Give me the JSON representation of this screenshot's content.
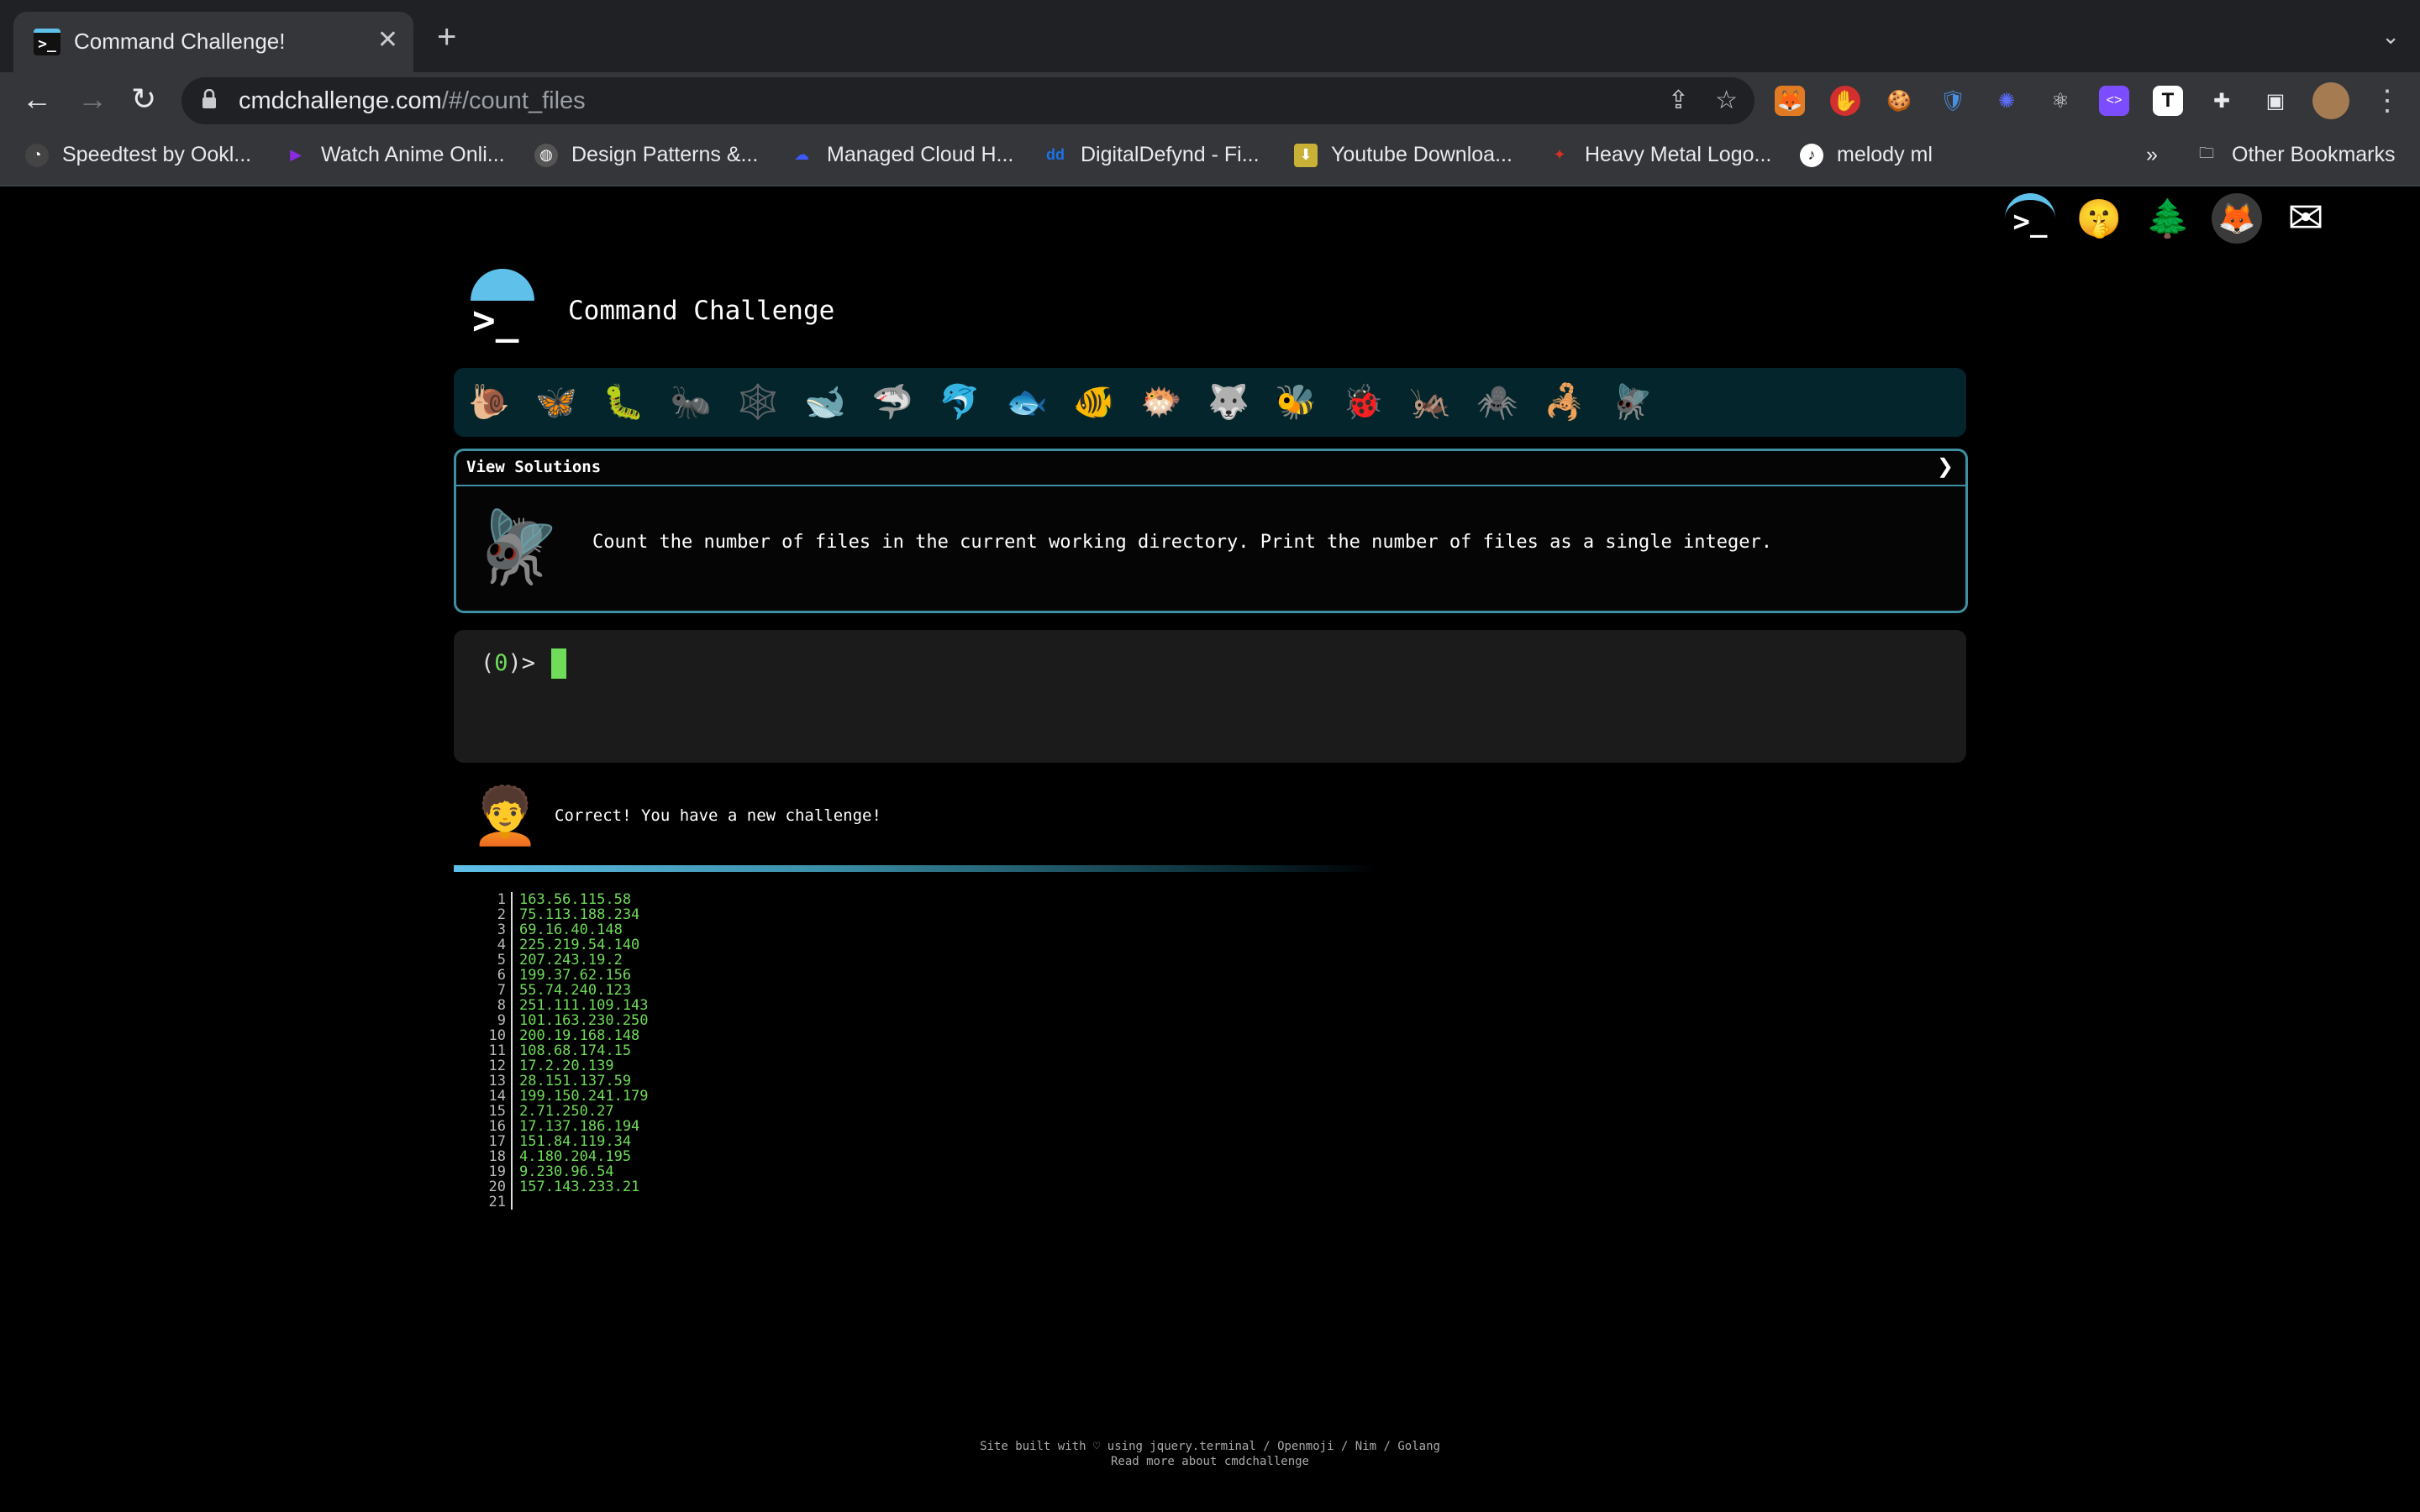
{
  "browser": {
    "tab_title": "Command Challenge!",
    "tab_favicon": ">_",
    "url_domain": "cmdchallenge.com",
    "url_path": "/#/count_files",
    "bookmarks": [
      {
        "label": "Speedtest by Ookl...",
        "icon": "speedtest-icon",
        "color": "#444"
      },
      {
        "label": "Watch Anime Onli...",
        "icon": "play-icon",
        "color": "#8a2be2"
      },
      {
        "label": "Design Patterns &...",
        "icon": "globe-icon",
        "color": "#555"
      },
      {
        "label": "Managed Cloud H...",
        "icon": "cloud-icon",
        "color": "#3d5afe"
      },
      {
        "label": "DigitalDefynd - Fi...",
        "icon": "dd-icon",
        "color": "#1a73e8"
      },
      {
        "label": "Youtube Downloa...",
        "icon": "download-icon",
        "color": "#c9b037"
      },
      {
        "label": "Heavy Metal Logo...",
        "icon": "flame-icon",
        "color": "#d93025"
      },
      {
        "label": "melody ml",
        "icon": "music-note-icon",
        "color": "#111"
      }
    ],
    "overflow": "»",
    "other_bookmarks": "Other Bookmarks"
  },
  "header": {
    "site_title": "Command Challenge",
    "logo_glyph": ">_"
  },
  "critters": [
    "🐌",
    "🦋",
    "🐛",
    "🐜",
    "🕸️",
    "🐋",
    "🦈",
    "🐬",
    "🐟",
    "🐠",
    "🐡",
    "🐺",
    "🐝",
    "🐞",
    "🦗",
    "🕷️",
    "🦂",
    "🪰"
  ],
  "challenge": {
    "view_solutions": "View Solutions",
    "chevron": "❯",
    "icon": "🪰",
    "text": "Count the number of files in the current working directory. Print the number of files as a single integer."
  },
  "terminal": {
    "prompt_open": "(",
    "prompt_count": "0",
    "prompt_close": ")>"
  },
  "feedback": {
    "avatar": "🧑‍🦱",
    "text": "Correct! You have a new challenge!"
  },
  "files": [
    {
      "n": "1",
      "ip": "163.56.115.58"
    },
    {
      "n": "2",
      "ip": "75.113.188.234"
    },
    {
      "n": "3",
      "ip": "69.16.40.148"
    },
    {
      "n": "4",
      "ip": "225.219.54.140"
    },
    {
      "n": "5",
      "ip": "207.243.19.2"
    },
    {
      "n": "6",
      "ip": "199.37.62.156"
    },
    {
      "n": "7",
      "ip": "55.74.240.123"
    },
    {
      "n": "8",
      "ip": "251.111.109.143"
    },
    {
      "n": "9",
      "ip": "101.163.230.250"
    },
    {
      "n": "10",
      "ip": "200.19.168.148"
    },
    {
      "n": "11",
      "ip": "108.68.174.15"
    },
    {
      "n": "12",
      "ip": "17.2.20.139"
    },
    {
      "n": "13",
      "ip": "28.151.137.59"
    },
    {
      "n": "14",
      "ip": "199.150.241.179"
    },
    {
      "n": "15",
      "ip": "2.71.250.27"
    },
    {
      "n": "16",
      "ip": "17.137.186.194"
    },
    {
      "n": "17",
      "ip": "151.84.119.34"
    },
    {
      "n": "18",
      "ip": "4.180.204.195"
    },
    {
      "n": "19",
      "ip": "9.230.96.54"
    },
    {
      "n": "20",
      "ip": "157.143.233.21"
    },
    {
      "n": "21",
      "ip": ""
    }
  ],
  "footer": {
    "line1": "Site built with ♡ using jquery.terminal / Openmoji / Nim / Golang",
    "line2": "Read more about cmdchallenge"
  },
  "colors": {
    "accent": "#5fc0e9",
    "terminal_green": "#6fdc5a",
    "box_border": "#3f8fa3"
  }
}
